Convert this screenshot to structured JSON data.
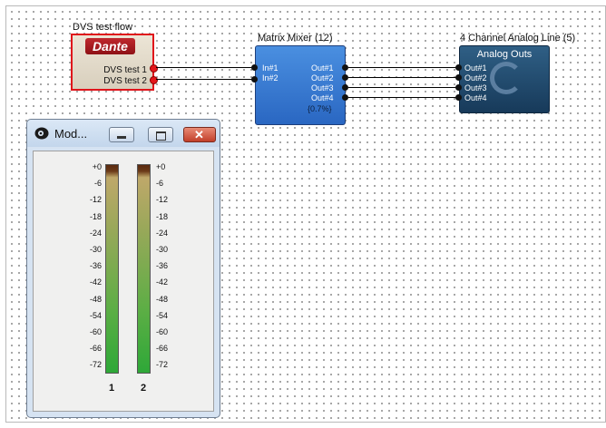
{
  "blocks": {
    "dante": {
      "title": "DVS test flow",
      "logo": "Dante",
      "channels": [
        "DVS test 1",
        "DVS test 2"
      ]
    },
    "matrix": {
      "title": "Matrix Mixer (12)",
      "inputs": [
        "In#1",
        "In#2"
      ],
      "outputs": [
        "Out#1",
        "Out#2",
        "Out#3",
        "Out#4"
      ],
      "usage": "{0.7%}"
    },
    "analog": {
      "title": "4 Channel Analog Line (5)",
      "header": "Analog Outs",
      "outputs": [
        "Out#1",
        "Out#2",
        "Out#3",
        "Out#4"
      ]
    }
  },
  "meter_window": {
    "title": "Mod...",
    "icons": {
      "app": "speaker-icon",
      "minimize": "minimize-icon",
      "maximize": "maximize-icon",
      "close": "close-icon"
    },
    "scale": [
      "+0",
      "-6",
      "-12",
      "-18",
      "-24",
      "-30",
      "-36",
      "-42",
      "-48",
      "-54",
      "-60",
      "-66",
      "-72"
    ],
    "channels": [
      "1",
      "2"
    ]
  },
  "colors": {
    "selection": "#e0141b",
    "matrix_block": "#3b7bd6",
    "analog_block": "#1f4a6e",
    "port_red": "#e4161a"
  }
}
